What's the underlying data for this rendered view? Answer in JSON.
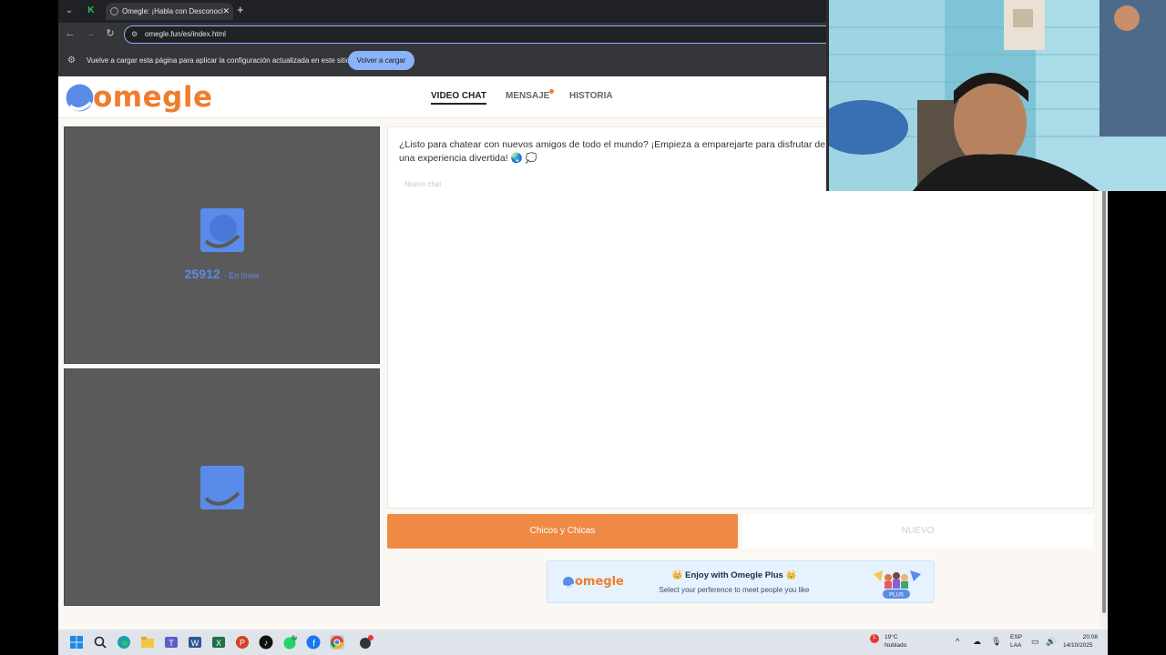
{
  "browser": {
    "tab_title": "Omegle: ¡Habla con Desconoci",
    "url": "omegle.fun/es/index.html",
    "infobar_message": "Vuelve a cargar esta página para aplicar la configuración actualizada en este sitio",
    "infobar_button": "Volver a cargar"
  },
  "site": {
    "logo_text": "omegle",
    "nav": [
      {
        "label": "VIDEO CHAT"
      },
      {
        "label": "MENSAJE"
      },
      {
        "label": "HISTORIA"
      }
    ],
    "online_count": "25912",
    "online_label": "· En línea",
    "chat_intro": "¿Listo para chatear con nuevos amigos de todo el mundo? ¡Empieza a emparejarte para disfrutar de una experiencia divertida! 🌏 💭",
    "chat_placeholder": "Nuevo chat",
    "gender_button": "Chicos y Chicas",
    "new_button": "NUEVO",
    "banner": {
      "logo": "omegle",
      "title": "👑 Enjoy with Omegle Plus 👑",
      "subtitle": "Select your perference to meet people you like",
      "badge": "PLUS"
    }
  },
  "taskbar": {
    "weather_temp": "19°C",
    "weather_desc": "Nublado",
    "weather_badge": "1",
    "lang_top": "ESP",
    "lang_bottom": "LAA",
    "time": "20:08",
    "date": "14/10/2025",
    "whatsapp_badge": "4"
  },
  "colors": {
    "brand_orange": "#ef7d2d",
    "brand_blue": "#5b8be8",
    "video_bg": "#5a5a5a",
    "chrome_dark": "#202124"
  }
}
